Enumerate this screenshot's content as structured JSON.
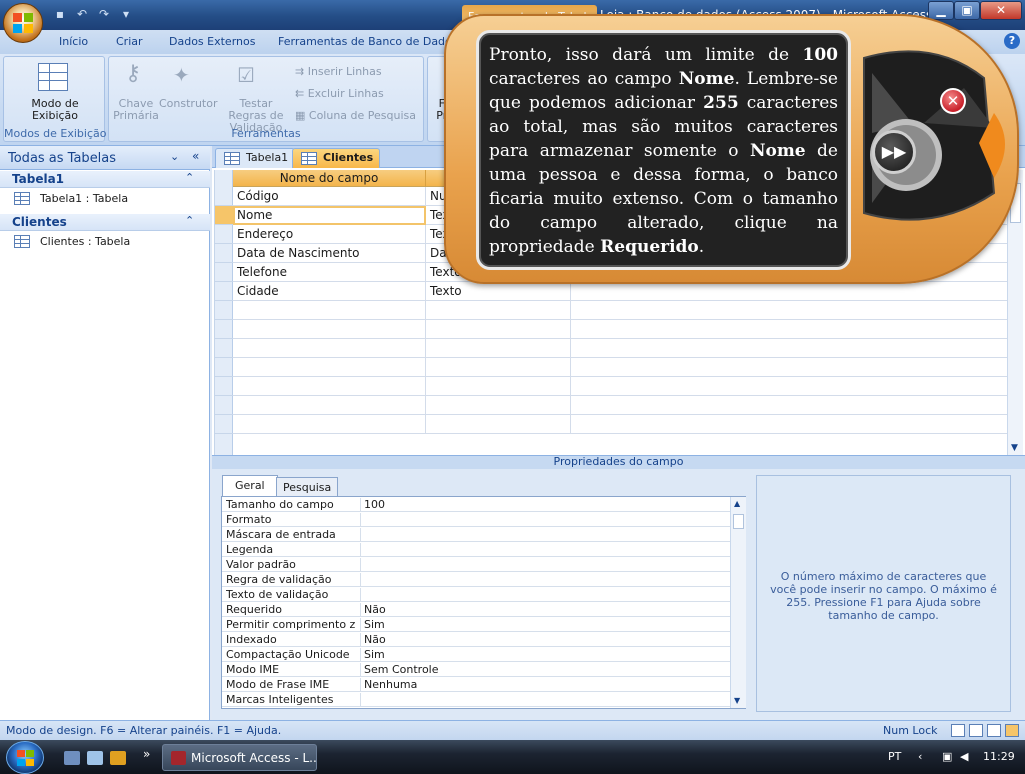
{
  "window": {
    "title": "Loja : Banco de dados (Access 2007) - Microsoft Access",
    "context_tab": "Ferramentas de Tabela",
    "minimize": "▁",
    "maximize": "▣",
    "close": "✕"
  },
  "ribbon_tabs": [
    "Início",
    "Criar",
    "Dados Externos",
    "Ferramentas de Banco de Dados"
  ],
  "ribbon": {
    "view_btn": "Modo de Exibição",
    "group_views": "Modos de Exibição",
    "primary_key": "Chave Primária",
    "builder": "Construtor",
    "test_rules": "Testar Regras de Validação",
    "insert_rows": "Inserir Linhas",
    "delete_rows": "Excluir Linhas",
    "lookup_col": "Coluna de Pesquisa",
    "group_tools": "Ferramentas",
    "partial_btn": "Fo Pro"
  },
  "nav": {
    "header": "Todas as Tabelas",
    "groups": [
      {
        "name": "Tabela1",
        "item": "Tabela1 : Tabela"
      },
      {
        "name": "Clientes",
        "item": "Clientes : Tabela"
      }
    ]
  },
  "doc_tabs": [
    "Tabela1",
    "Clientes"
  ],
  "design_grid": {
    "header_field": "Nome do campo",
    "rows": [
      {
        "field": "Código",
        "type": "Num"
      },
      {
        "field": "Nome",
        "type": "Texto"
      },
      {
        "field": "Endereço",
        "type": "Texto"
      },
      {
        "field": "Data de Nascimento",
        "type": "Data/Ho"
      },
      {
        "field": "Telefone",
        "type": "Texto"
      },
      {
        "field": "Cidade",
        "type": "Texto"
      }
    ]
  },
  "properties": {
    "bar_title": "Propriedades do campo",
    "tab_general": "Geral",
    "tab_lookup": "Pesquisa",
    "rows": [
      {
        "name": "Tamanho do campo",
        "value": "100"
      },
      {
        "name": "Formato",
        "value": ""
      },
      {
        "name": "Máscara de entrada",
        "value": ""
      },
      {
        "name": "Legenda",
        "value": ""
      },
      {
        "name": "Valor padrão",
        "value": ""
      },
      {
        "name": "Regra de validação",
        "value": ""
      },
      {
        "name": "Texto de validação",
        "value": ""
      },
      {
        "name": "Requerido",
        "value": "Não"
      },
      {
        "name": "Permitir comprimento zer",
        "value": "Sim"
      },
      {
        "name": "Indexado",
        "value": "Não"
      },
      {
        "name": "Compactação Unicode",
        "value": "Sim"
      },
      {
        "name": "Modo IME",
        "value": "Sem Controle"
      },
      {
        "name": "Modo de Frase IME",
        "value": "Nenhuma"
      },
      {
        "name": "Marcas Inteligentes",
        "value": ""
      }
    ],
    "help_text": "O número máximo de caracteres que você pode inserir no campo. O máximo é 255. Pressione F1 para Ajuda sobre tamanho de campo."
  },
  "status": {
    "left": "Modo de design. F6 = Alterar painéis. F1 = Ajuda.",
    "right": "Num Lock"
  },
  "taskbar": {
    "app_button": "Microsoft Access - L...",
    "lang": "PT",
    "time": "11:29"
  },
  "tutorial": {
    "p1": "Pronto, isso dará um limite de ",
    "b1": "100",
    "p2": " caracteres ao campo ",
    "b2": "Nome",
    "p3": ". Lembre-se que podemos adicionar ",
    "b3": "255",
    "p4": " caracteres ao total, mas são muitos caracteres para armazenar somente o ",
    "b4": "Nome",
    "p5": " de uma pessoa e dessa forma, o banco ficaria muito extenso. Com o tamanho do campo alterado, clique na propriedade ",
    "b5": "Requerido",
    "p6": "."
  },
  "colors": {
    "accent": "#f3b44b",
    "ribbon_text": "#15428b"
  }
}
